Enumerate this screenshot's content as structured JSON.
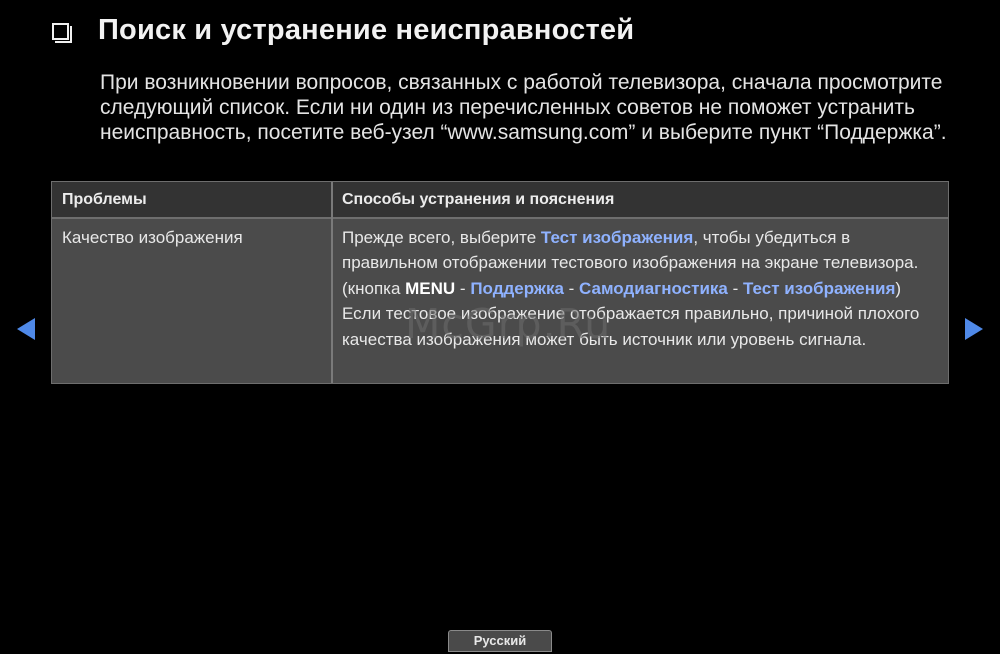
{
  "header": {
    "checkbox_icon": "checkbox-icon",
    "title": "Поиск и устранение неисправностей"
  },
  "intro": {
    "text": "При возникновении вопросов, связанных с работой телевизора, сначала просмотрите следующий список. Если ни один из перечисленных советов не поможет устранить неисправность, посетите веб-узел “www.samsung.com” и выберите пункт “Поддержка”."
  },
  "table": {
    "headers": [
      "Проблемы",
      "Способы устранения и пояснения"
    ],
    "rows": [
      {
        "problem": "Качество изображения",
        "solution": {
          "part1": "Прежде всего, выберите ",
          "link1": "Тест изображения",
          "part2": ", чтобы убедиться в правильном отображении тестового изображения на экране телевизора. (кнопка ",
          "menu": "MENU",
          "sep1": " - ",
          "link2": "Поддержка",
          "sep2": " - ",
          "link3": "Самодиагностика",
          "sep3": " - ",
          "link4": "Тест изображения",
          "part3": ") Если тестовое изображение отображается правильно, причиной плохого качества изображения может быть источник или уровень сигнала."
        }
      }
    ]
  },
  "navigation": {
    "prev_icon": "arrow-left-icon",
    "next_icon": "arrow-right-icon"
  },
  "watermark": {
    "text": "McGrp.Ru"
  },
  "footer": {
    "language": "Русский"
  },
  "colors": {
    "background": "#000000",
    "highlight": "#8fb2ff",
    "arrow": "#4f89e8",
    "table_body": "#4b4b4b",
    "table_header": "#333333"
  }
}
